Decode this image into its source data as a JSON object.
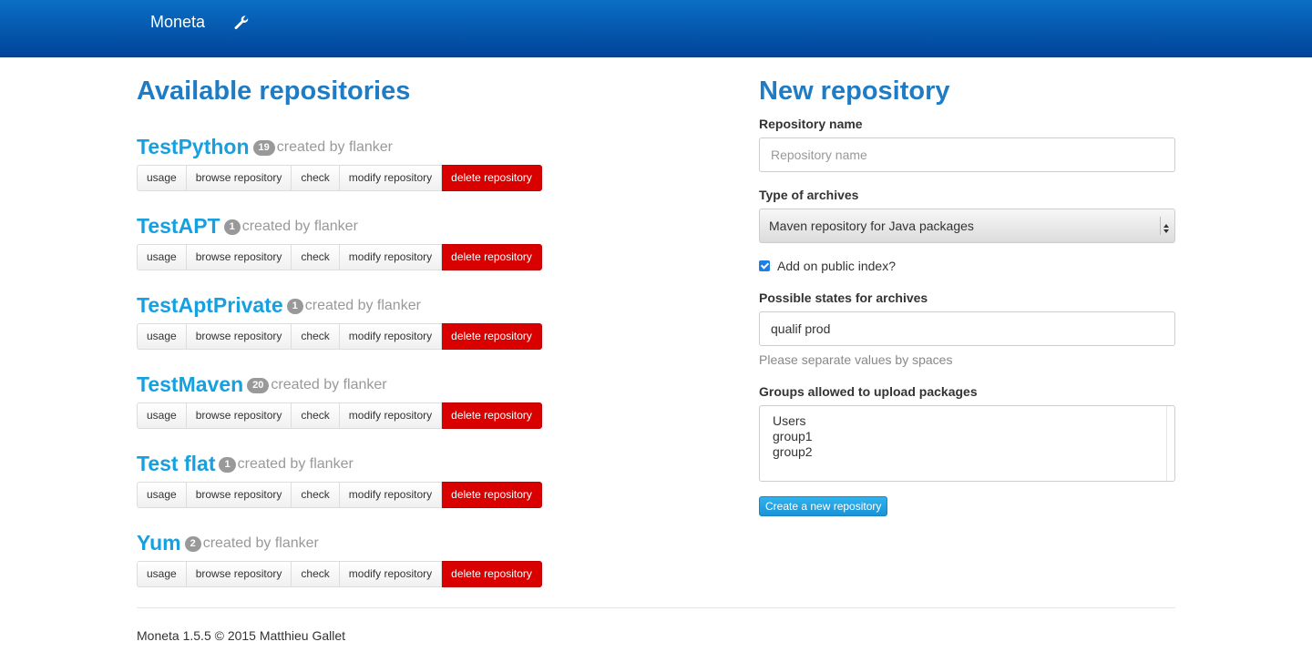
{
  "navbar": {
    "brand": "Moneta",
    "settings_icon": "wrench-icon"
  },
  "repositories_section": {
    "title": "Available repositories",
    "actions": [
      "usage",
      "browse repository",
      "check",
      "modify repository",
      "delete repository"
    ],
    "items": [
      {
        "name": "TestPython",
        "count": "19",
        "created_by": "created by flanker"
      },
      {
        "name": "TestAPT",
        "count": "1",
        "created_by": "created by flanker"
      },
      {
        "name": "TestAptPrivate",
        "count": "1",
        "created_by": "created by flanker"
      },
      {
        "name": "TestMaven",
        "count": "20",
        "created_by": "created by flanker"
      },
      {
        "name": "Test flat",
        "count": "1",
        "created_by": "created by flanker"
      },
      {
        "name": "Yum",
        "count": "2",
        "created_by": "created by flanker"
      }
    ]
  },
  "new_repository": {
    "title": "New repository",
    "name_label": "Repository name",
    "name_placeholder": "Repository name",
    "type_label": "Type of archives",
    "type_value": "Maven repository for Java packages",
    "public_label": "Add on public index?",
    "public_checked": true,
    "states_label": "Possible states for archives",
    "states_value": "qualif prod",
    "states_help": "Please separate values by spaces",
    "groups_label": "Groups allowed to upload packages",
    "groups": [
      "Users",
      "group1",
      "group2"
    ],
    "submit_label": "Create a new repository"
  },
  "colors": {
    "navbar": "#00449a",
    "title": "#1f7cc4",
    "link": "#17a0e0",
    "danger": "#d90000",
    "primary": "#1a93d6"
  },
  "footer": {
    "text": "Moneta 1.5.5 © 2015 Matthieu Gallet"
  }
}
